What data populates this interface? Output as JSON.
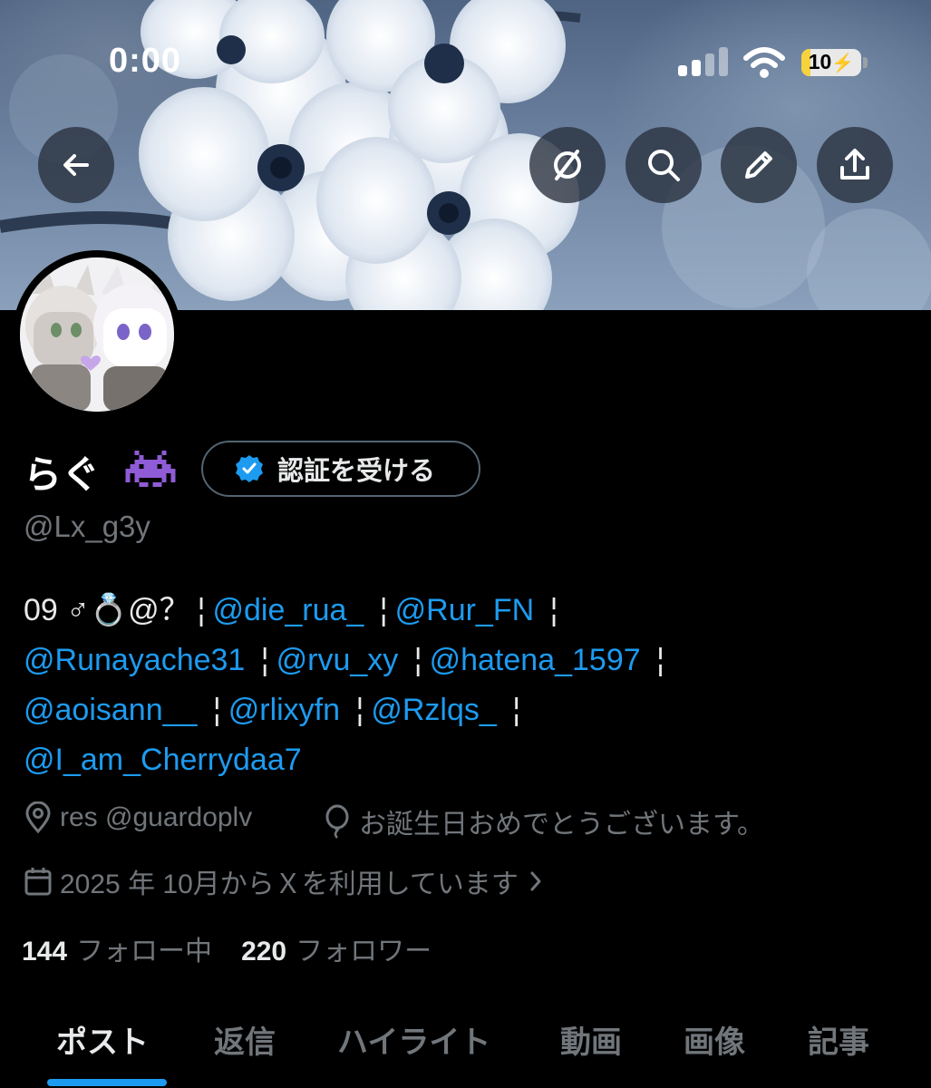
{
  "status_bar": {
    "time": "0:00",
    "battery": "10",
    "battery_level": 0.1
  },
  "profile": {
    "name": "らぐ",
    "name_emoji": "alien-monster",
    "verify_label": "認証を受ける",
    "handle": "@Lx_g3y"
  },
  "bio": {
    "lines": [
      [
        {
          "type": "plain",
          "text": "09 ♂💍@？"
        },
        {
          "type": "sep",
          "text": "¦"
        },
        {
          "type": "mention",
          "text": "@die_rua_"
        },
        {
          "type": "sep",
          "text": "¦"
        },
        {
          "type": "mention",
          "text": "@Rur_FN"
        },
        {
          "type": "sep",
          "text": "¦"
        }
      ],
      [
        {
          "type": "mention",
          "text": "@Runayache31"
        },
        {
          "type": "sep",
          "text": "¦"
        },
        {
          "type": "mention",
          "text": "@rvu_xy"
        },
        {
          "type": "sep",
          "text": "¦"
        },
        {
          "type": "mention",
          "text": "@hatena_1597"
        },
        {
          "type": "sep",
          "text": "¦"
        }
      ],
      [
        {
          "type": "mention",
          "text": "@aoisann__"
        },
        {
          "type": "sep",
          "text": "¦"
        },
        {
          "type": "mention",
          "text": "@rlixyfn"
        },
        {
          "type": "sep",
          "text": "¦"
        },
        {
          "type": "mention",
          "text": "@Rzlqs_"
        },
        {
          "type": "sep",
          "text": "¦"
        }
      ],
      [
        {
          "type": "mention",
          "text": "@I_am_Cherrydaa7"
        }
      ]
    ]
  },
  "meta": {
    "location": "res @guardoplv",
    "birthday": "お誕生日おめでとうございます。",
    "joined": "2025 年 10月からＸを利用しています"
  },
  "counts": {
    "following_num": "144",
    "following_label": "フォロー中",
    "followers_num": "220",
    "followers_label": "フォロワー"
  },
  "tabs": [
    "ポスト",
    "返信",
    "ハイライト",
    "動画",
    "画像",
    "記事"
  ],
  "colors": {
    "accent": "#1d9bf0",
    "muted": "#71767b",
    "background": "#000000"
  }
}
